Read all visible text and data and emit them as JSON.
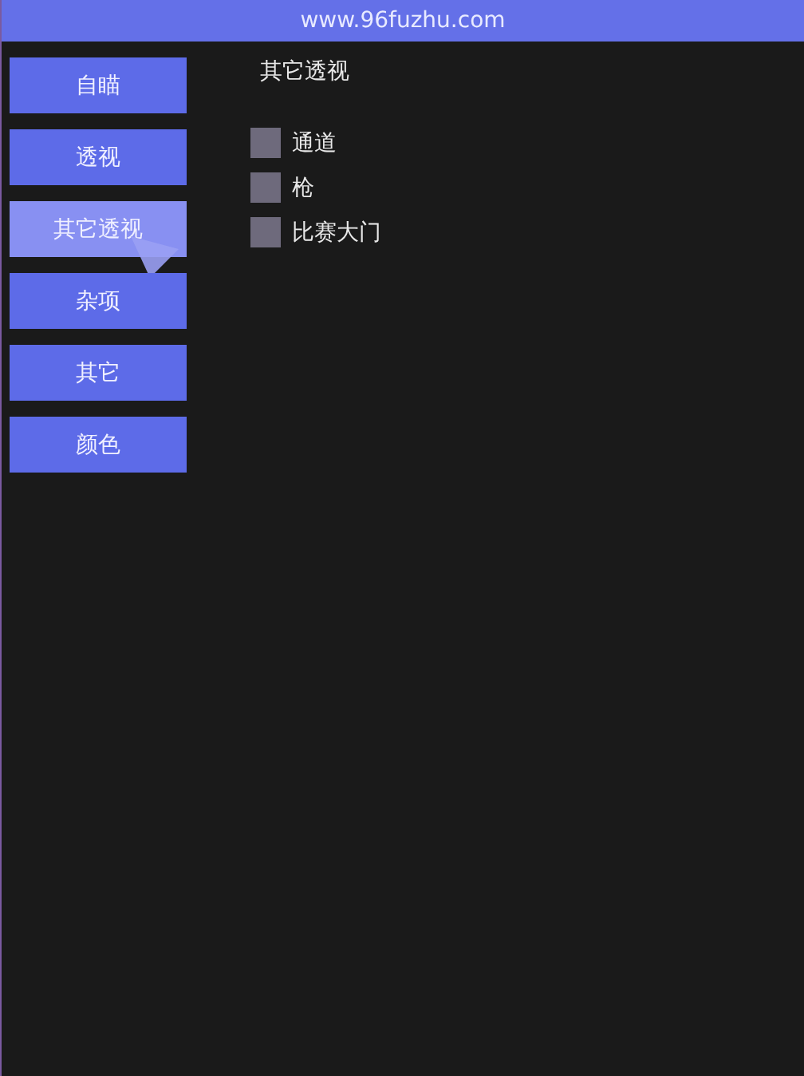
{
  "window": {
    "title": "www.96fuzhu.com"
  },
  "sidebar": {
    "items": [
      {
        "label": "自瞄",
        "selected": false
      },
      {
        "label": "透视",
        "selected": false
      },
      {
        "label": "其它透视",
        "selected": true
      },
      {
        "label": "杂项",
        "selected": false
      },
      {
        "label": "其它",
        "selected": false
      },
      {
        "label": "颜色",
        "selected": false
      }
    ]
  },
  "panel": {
    "title": "其它透视",
    "options": [
      {
        "label": "通道",
        "checked": false
      },
      {
        "label": "枪",
        "checked": false
      },
      {
        "label": "比赛大门",
        "checked": false
      }
    ]
  }
}
